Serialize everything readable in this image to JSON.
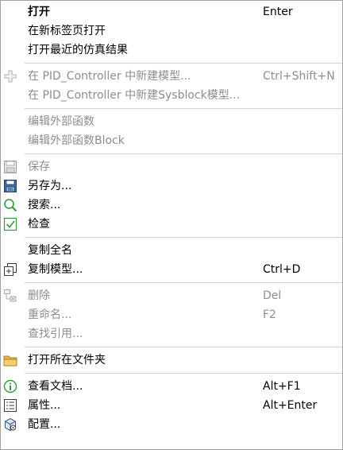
{
  "menu": {
    "open": {
      "label": "打开",
      "shortcut": "Enter"
    },
    "open_new_tab": {
      "label": "在新标签页打开"
    },
    "open_recent_results": {
      "label": "打开最近的仿真结果"
    },
    "new_model": {
      "label": "在 PID_Controller 中新建模型...",
      "shortcut": "Ctrl+Shift+N"
    },
    "new_sysblock": {
      "label": "在 PID_Controller 中新建Sysblock模型..."
    },
    "edit_external_function": {
      "label": "编辑外部函数"
    },
    "edit_external_function_block": {
      "label": "编辑外部函数Block"
    },
    "save": {
      "label": "保存"
    },
    "save_as": {
      "label": "另存为..."
    },
    "search": {
      "label": "搜索..."
    },
    "check": {
      "label": "检查"
    },
    "copy_full_name": {
      "label": "复制全名"
    },
    "copy_model": {
      "label": "复制模型...",
      "shortcut": "Ctrl+D"
    },
    "delete": {
      "label": "删除",
      "shortcut": "Del"
    },
    "rename": {
      "label": "重命名...",
      "shortcut": "F2"
    },
    "find_references": {
      "label": "查找引用..."
    },
    "open_folder": {
      "label": "打开所在文件夹"
    },
    "view_docs": {
      "label": "查看文档...",
      "shortcut": "Alt+F1"
    },
    "properties": {
      "label": "属性...",
      "shortcut": "Alt+Enter"
    },
    "configure": {
      "label": "配置..."
    }
  },
  "colors": {
    "disabled_text": "#8d8d8d",
    "separator": "#d4d4d4",
    "folder_icon": "#e8b64a",
    "search_icon": "#2f9a3a",
    "check_icon": "#2f9a3a",
    "info_icon": "#2f9a3a"
  }
}
